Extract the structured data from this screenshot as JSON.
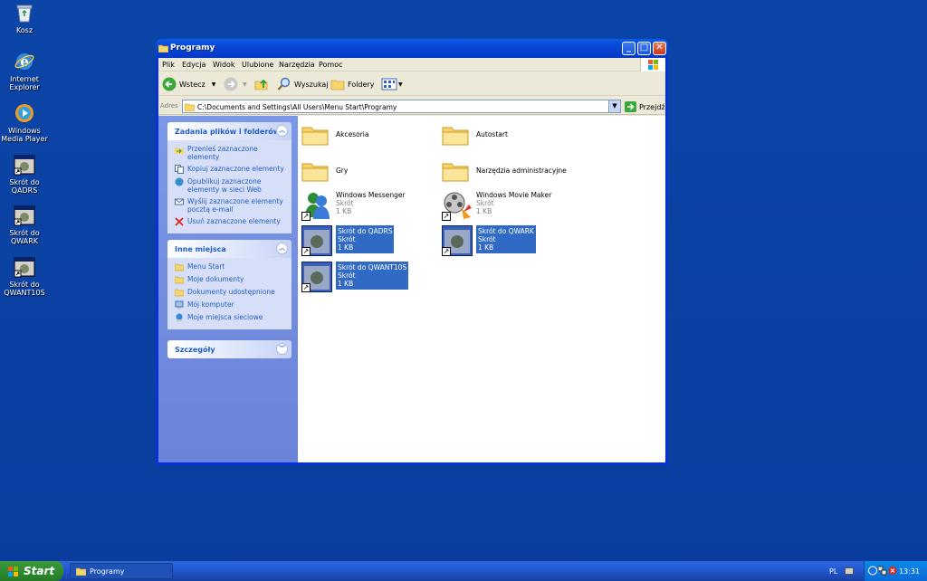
{
  "desktop": {
    "icons": [
      {
        "label": "Kosz",
        "icon": "recycle-bin-icon"
      },
      {
        "label": "Internet Explorer",
        "icon": "internet-explorer-icon"
      },
      {
        "label": "Windows Media Player",
        "icon": "media-player-icon"
      },
      {
        "label": "Skrót do QADRS",
        "icon": "shortcut-app-icon"
      },
      {
        "label": "Skrót do QWARK",
        "icon": "shortcut-app-icon"
      },
      {
        "label": "Skrót do QWANT10S",
        "icon": "shortcut-app-icon"
      }
    ]
  },
  "window": {
    "title": "Programy",
    "menu": [
      "Plik",
      "Edycja",
      "Widok",
      "Ulubione",
      "Narzędzia",
      "Pomoc"
    ],
    "toolbar": {
      "back_label": "Wstecz",
      "search_label": "Wyszukaj",
      "folders_label": "Foldery"
    },
    "address": {
      "label": "Adres",
      "value": "C:\\Documents and Settings\\All Users\\Menu Start\\Programy",
      "go_label": "Przejdź"
    },
    "taskpane": {
      "file_tasks": {
        "title": "Zadania plików i folderów",
        "items": [
          "Przenieś zaznaczone elementy",
          "Kopiuj zaznaczone elementy",
          "Opublikuj zaznaczone elementy w sieci Web",
          "Wyślij zaznaczone elementy pocztą e-mail",
          "Usuń zaznaczone elementy"
        ]
      },
      "other_places": {
        "title": "Inne miejsca",
        "items": [
          "Menu Start",
          "Moje dokumenty",
          "Dokumenty udostępnione",
          "Mój komputer",
          "Moje miejsca sieciowe"
        ]
      },
      "details": {
        "title": "Szczegóły"
      }
    },
    "files": [
      {
        "name": "Akcesoria",
        "type": "folder"
      },
      {
        "name": "Autostart",
        "type": "folder"
      },
      {
        "name": "Gry",
        "type": "folder"
      },
      {
        "name": "Narzędzia administracyjne",
        "type": "folder"
      },
      {
        "name": "Windows Messenger",
        "kind": "Skrót",
        "size": "1 KB",
        "type": "shortcut"
      },
      {
        "name": "Windows Movie Maker",
        "kind": "Skrót",
        "size": "1 KB",
        "type": "shortcut"
      },
      {
        "name": "Skrót do QADRS",
        "kind": "Skrót",
        "size": "1 KB",
        "type": "shortcut",
        "selected": true
      },
      {
        "name": "Skrót do QWARK",
        "kind": "Skrót",
        "size": "1 KB",
        "type": "shortcut",
        "selected": true
      },
      {
        "name": "Skrót do QWANT10S",
        "kind": "Skrót",
        "size": "1 KB",
        "type": "shortcut",
        "selected": true
      }
    ]
  },
  "taskbar": {
    "start_label": "Start",
    "task_label": "Programy",
    "language": "PL",
    "clock": "13:31"
  }
}
